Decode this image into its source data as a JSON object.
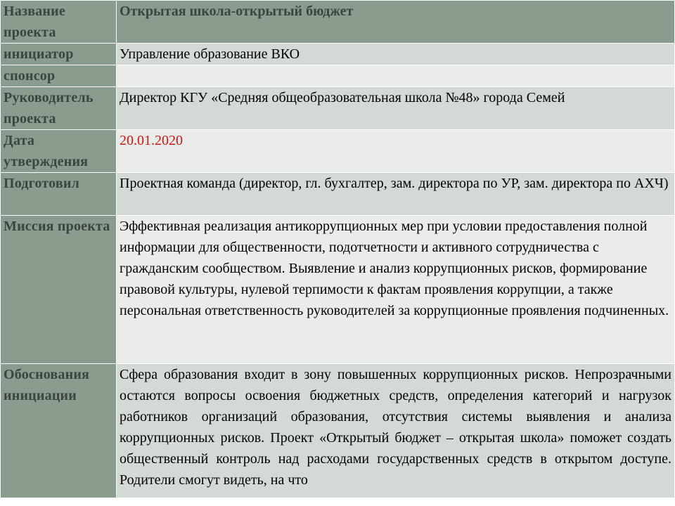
{
  "rows": [
    {
      "label": "Название проекта",
      "value": "Открытая школа-открытый бюджет"
    },
    {
      "label": "инициатор",
      "value": "Управление образование ВКО"
    },
    {
      "label": "спонсор",
      "value": ""
    },
    {
      "label": "Руководитель проекта",
      "value": "Директор КГУ «Средняя общеобразовательная школа №48» города Семей"
    },
    {
      "label": "Дата утверждения",
      "value": "20.01.2020"
    },
    {
      "label": "Подготовил",
      "value": "Проектная команда (директор, гл. бухгалтер, зам. директора по УР, зам. директора по АХЧ)"
    },
    {
      "label": "Миссия проекта",
      "value": "Эффективная реализация антикоррупционных мер при условии предоставления полной информации для общественности, подотчетности и активного сотрудничества с гражданским сообществом. Выявление и анализ коррупционных рисков, формирование правовой культуры, нулевой терпимости к фактам проявления коррупции, а также персональная ответственность руководителей за коррупционные проявления подчиненных."
    },
    {
      "label": "Обоснования инициации",
      "value": "Сфера образования входит в зону повышенных коррупционных рисков. Непрозрачными остаются вопросы освоения бюджетных средств, определения категорий и нагрузок работников организаций образования, отсутствия системы выявления и анализа коррупционных рисков. Проект «Открытый бюджет – открытая школа» поможет создать общественный контроль над расходами государственных средств в открытом доступе. Родители смогут видеть, на что"
    }
  ],
  "colors": {
    "label_bg": "#8a9c8e",
    "label_text": "#3a463c",
    "row_alt_a": "#d3d9d4",
    "row_alt_b": "#e9ece9",
    "date_color": "#cc1414"
  }
}
